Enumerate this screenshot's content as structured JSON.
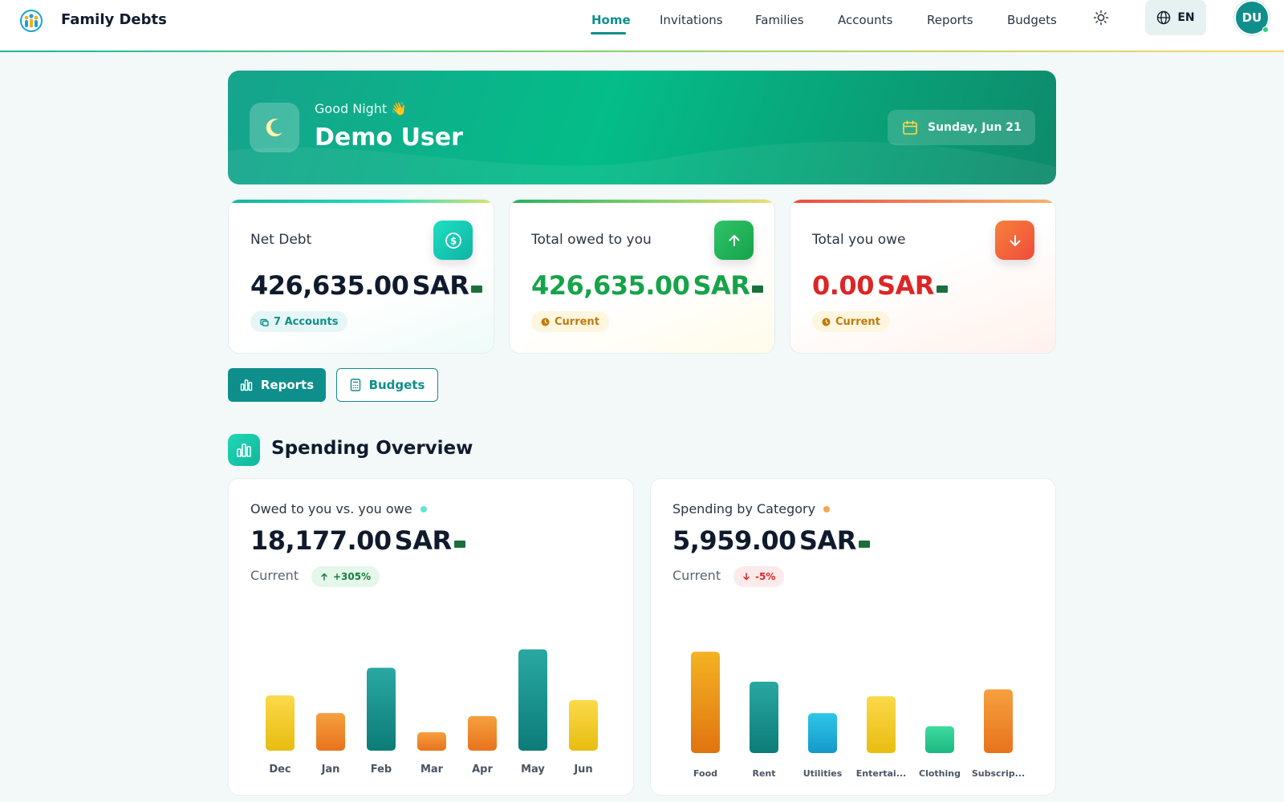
{
  "nav": {
    "brand": "Family Debts",
    "links": [
      "Home",
      "Invitations",
      "Families",
      "Accounts",
      "Reports",
      "Budgets"
    ],
    "active_link": "Home",
    "language": "EN",
    "avatar_initials": "DU"
  },
  "hero": {
    "greeting": "Good Night 👋",
    "user_name": "Demo User",
    "date": "Sunday, Jun 21"
  },
  "stats": {
    "net_debt": {
      "label": "Net Debt",
      "amount": "426,635.00",
      "currency": "SAR",
      "chip": "7 Accounts"
    },
    "owed_to_you": {
      "label": "Total owed to you",
      "amount": "426,635.00",
      "currency": "SAR",
      "chip": "Current"
    },
    "you_owe": {
      "label": "Total you owe",
      "amount": "0.00",
      "currency": "SAR",
      "chip": "Current"
    }
  },
  "actions": {
    "reports": "Reports",
    "budgets": "Budgets"
  },
  "section": {
    "title": "Spending Overview"
  },
  "charts": {
    "owed": {
      "title": "Owed to you vs. you owe",
      "amount": "18,177.00",
      "currency": "SAR",
      "sub": "Current",
      "change": "+305%"
    },
    "category": {
      "title": "Spending by Category",
      "amount": "5,959.00",
      "currency": "SAR",
      "sub": "Current",
      "change": "-5%"
    }
  },
  "colors": {
    "primary": "#0f8f8c",
    "positive": "#16a34a",
    "negative": "#dc2626",
    "bar_yellow": "#f2c624",
    "bar_orange": "#ee8a2a",
    "bar_teal": "#128f87"
  },
  "chart_data": [
    {
      "type": "bar",
      "categories": [
        "Dec",
        "Jan",
        "Feb",
        "Mar",
        "Apr",
        "May",
        "Jun"
      ],
      "values": [
        72,
        49,
        108,
        24,
        45,
        132,
        66
      ],
      "bar_colors": [
        "yellow",
        "orange",
        "teal",
        "orange",
        "orange",
        "teal",
        "yellow"
      ],
      "ylim": [
        0,
        140
      ]
    },
    {
      "type": "bar",
      "categories": [
        "Food",
        "Rent",
        "Utilities",
        "Entertai...",
        "Clothing",
        "Subscrip..."
      ],
      "values": [
        132,
        93,
        52,
        74,
        35,
        83
      ],
      "bar_colors": [
        "orange-yellow",
        "teal",
        "blue",
        "yellow",
        "green",
        "orange"
      ],
      "ylim": [
        0,
        140
      ]
    }
  ]
}
